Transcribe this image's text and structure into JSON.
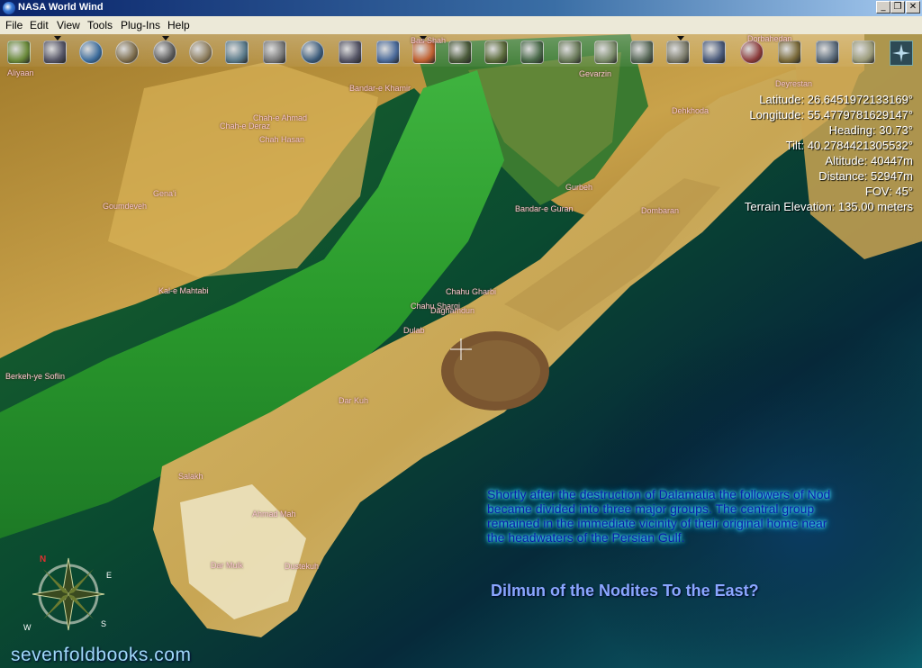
{
  "window": {
    "title": "NASA World Wind",
    "buttons": {
      "minimize": "_",
      "maximize": "❐",
      "close": "✕"
    }
  },
  "menu": {
    "items": [
      "File",
      "Edit",
      "View",
      "Tools",
      "Plug-Ins",
      "Help"
    ]
  },
  "toolbar": {
    "tools": [
      "layers-icon",
      "grid-icon",
      "globe-wireframe-icon",
      "planet-icon",
      "planet-icon",
      "crosshair-icon",
      "terrain-icon",
      "magnifier-icon",
      "globe-icon",
      "satellite-icon",
      "landsat-icon",
      "modis-icon",
      "colormap-icon",
      "imagery-icon",
      "imagery-icon",
      "imagery-icon",
      "imagery-icon",
      "imagery-icon",
      "imagery-icon",
      "imagery-icon",
      "globe-search-icon",
      "flag-map-icon",
      "flag-map-icon",
      "community-icon",
      "map-icon"
    ],
    "compass_label": "compass-icon"
  },
  "hud": {
    "latitude": "Latitude: 26.6451972133169°",
    "longitude": "Longitude: 55.4779781629147°",
    "heading": "Heading: 30.73°",
    "tilt": "Tilt: 40.2784421305532°",
    "altitude": "Altitude: 40447m",
    "distance": "Distance: 52947m",
    "fov": "FOV: 45°",
    "terrain": "Terrain Elevation: 135.00 meters"
  },
  "places": [
    "Aliyaan",
    "Bandar-e Khamir",
    "Chah-e Ahmad",
    "Chah-e Deraz",
    "Chah Hasan",
    "Gena'i",
    "Goumdeveh",
    "Kal-e Mahtabi",
    "Berkeh-ye Soflin",
    "Daghamdun",
    "Gevarzin",
    "Dehkhoda",
    "Deyrestan",
    "Dorbahedan",
    "Gurbeh",
    "Bandar-e Guran",
    "Dombaran",
    "Chahu Gharbi",
    "Chahu Sharqi",
    "Dulab",
    "Dar Kuh",
    "Salakh",
    "Ahmad Mah",
    "Dar Mulk",
    "Dustekuh",
    "Bas Shah"
  ],
  "overlay": {
    "story": "Shortly after the destruction of Dalamatia the followers of Nod became divided into three major groups. The central group remained in the immediate vicinity of their original home near the headwaters of the Persian Gulf.",
    "headline": "Dilmun of the Nodites To the East?",
    "watermark": "sevenfoldbooks.com"
  },
  "compass": {
    "n": "N",
    "e": "E",
    "s": "S",
    "w": "W"
  }
}
